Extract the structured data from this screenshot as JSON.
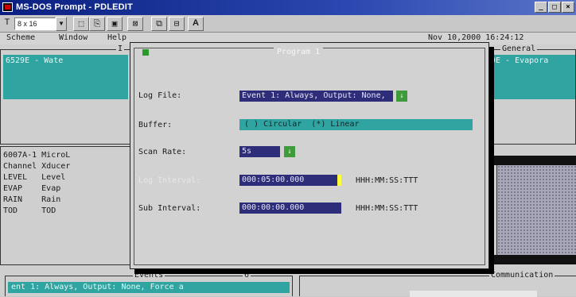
{
  "window": {
    "title": "MS-DOS Prompt - PDLEDIT",
    "buttons": [
      "_",
      "□",
      "×"
    ]
  },
  "toolbar": {
    "font_select": "8 x 16",
    "text_button": "A"
  },
  "menu": {
    "scheme": "Scheme",
    "window": "Window",
    "help": "Help",
    "datetime": "Nov 10,2000 16:24:12"
  },
  "panels": {
    "left_top_title": "I",
    "left_top_row": "6529E - Wate",
    "general_title": "General",
    "general_row": "9E - Evapora",
    "list_rows": [
      "6007A-1 MicroL",
      "Channel Xducer",
      "LEVEL   Level",
      "EVAP    Evap",
      "RAIN    Rain",
      "TOD     TOD"
    ],
    "events_title": "Events",
    "events_marker": "6",
    "events_row": "ent 1: Always, Output: None, Force a",
    "comm_title": "Communication"
  },
  "dialog": {
    "title": "Program 1",
    "log_file_label": "Log File:",
    "log_file_value": "Event 1: Always, Output: None,",
    "buffer_label": "Buffer:",
    "buffer_value": "( ) Circular  (*) Linear",
    "scan_rate_label": "Scan Rate:",
    "scan_rate_value": "5s",
    "log_interval_label": "Log Interval:",
    "log_interval_value": "000:05:00.000",
    "log_interval_format": "HHH:MM:SS:TTT",
    "sub_interval_label": "Sub Interval:",
    "sub_interval_value": "000:00:00.000",
    "sub_interval_format": "HHH:MM:SS:TTT",
    "dropdown_glyph": "↓"
  },
  "colors": {
    "teal": "#2fa4a0",
    "navy": "#2e2d7a",
    "green_button": "#3e9a3a",
    "title_bar": "#0a1f80"
  }
}
